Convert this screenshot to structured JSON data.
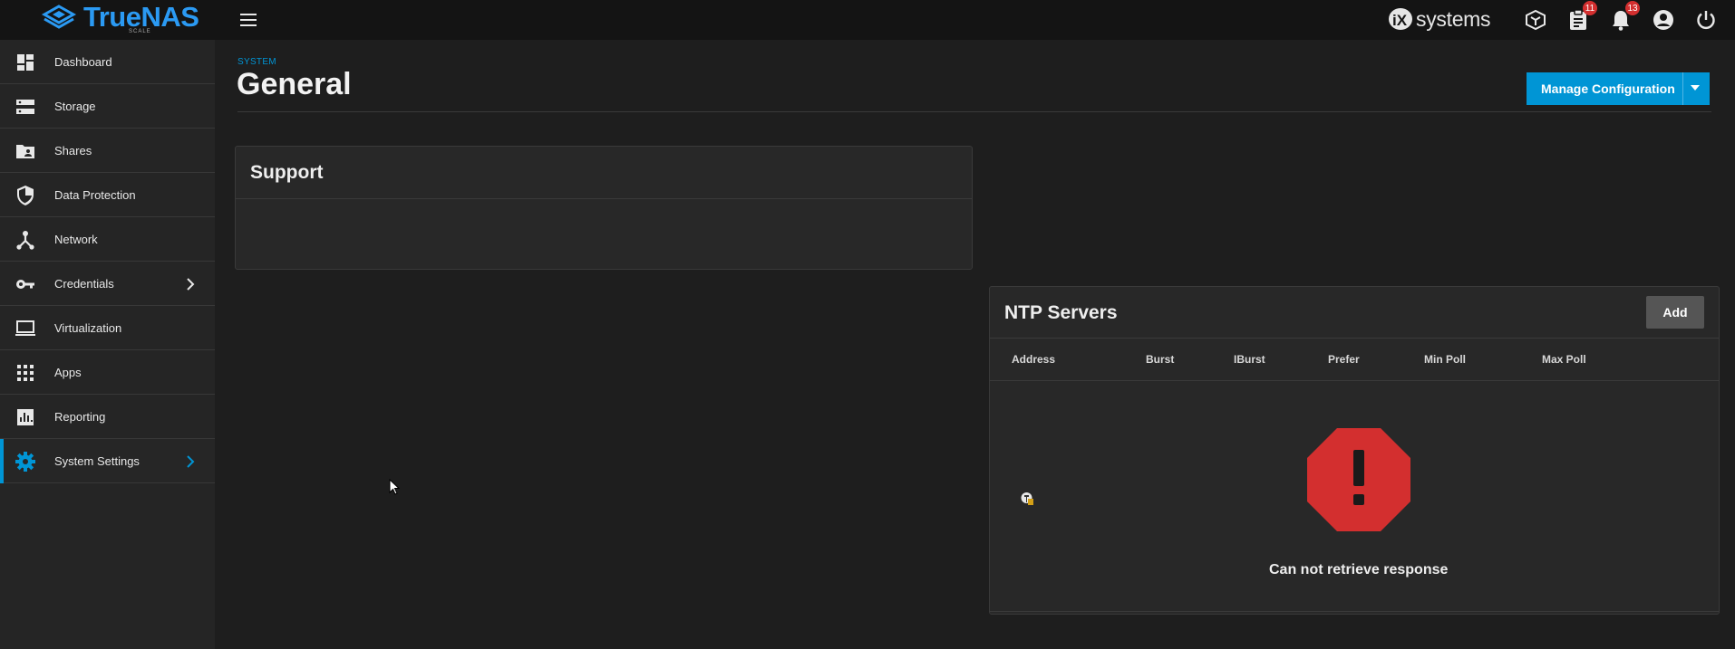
{
  "app": {
    "name": "TrueNAS",
    "edition": "SCALE"
  },
  "header": {
    "brand": "systems",
    "jobs_badge": "11",
    "alerts_badge": "13"
  },
  "sidebar": {
    "items": [
      {
        "label": "Dashboard",
        "icon": "dashboard-icon"
      },
      {
        "label": "Storage",
        "icon": "storage-icon"
      },
      {
        "label": "Shares",
        "icon": "folder-shared-icon"
      },
      {
        "label": "Data Protection",
        "icon": "shield-icon"
      },
      {
        "label": "Network",
        "icon": "network-icon"
      },
      {
        "label": "Credentials",
        "icon": "key-icon"
      },
      {
        "label": "Virtualization",
        "icon": "laptop-icon"
      },
      {
        "label": "Apps",
        "icon": "apps-grid-icon"
      },
      {
        "label": "Reporting",
        "icon": "chart-icon"
      },
      {
        "label": "System Settings",
        "icon": "gear-icon"
      }
    ],
    "active_item": "System Settings"
  },
  "page": {
    "section": "SYSTEM",
    "title": "General",
    "manage_button": "Manage Configuration"
  },
  "support_card": {
    "title": "Support"
  },
  "ntp_card": {
    "title": "NTP Servers",
    "add_button": "Add",
    "columns": [
      "Address",
      "Burst",
      "IBurst",
      "Prefer",
      "Min Poll",
      "Max Poll"
    ],
    "error_message": "Can not retrieve response"
  },
  "colors": {
    "accent": "#0095d5",
    "background": "#1e1e1e",
    "sidebar": "#252525",
    "card": "#282828",
    "error": "#d32f2f"
  }
}
